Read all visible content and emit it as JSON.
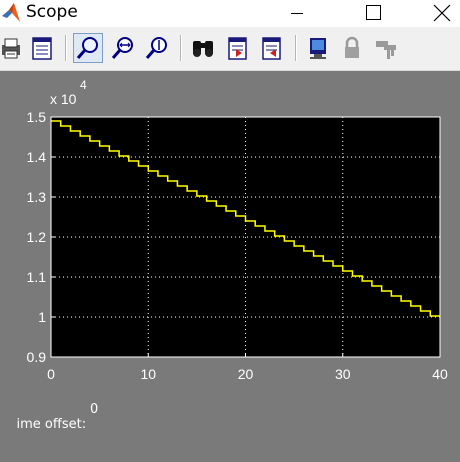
{
  "window": {
    "title": "Scope"
  },
  "titlebar_icons": [
    "matlab-logo-icon",
    "minimize-icon",
    "maximize-icon",
    "close-icon"
  ],
  "toolbar": {
    "buttons": [
      {
        "name": "print-icon"
      },
      {
        "name": "parameters-icon"
      },
      {
        "name": "zoom-icon"
      },
      {
        "name": "zoom-x-icon"
      },
      {
        "name": "zoom-y-icon"
      },
      {
        "name": "autoscale-binoculars-icon"
      },
      {
        "name": "save-axes-settings-icon"
      },
      {
        "name": "restore-axes-settings-icon"
      },
      {
        "name": "floating-scope-icon"
      },
      {
        "name": "lock-axes-icon"
      },
      {
        "name": "signal-selection-icon"
      }
    ]
  },
  "status": {
    "label": "ime offset:",
    "value": "0"
  },
  "colors": {
    "axes_bg": "#000000",
    "figure_bg": "#7a7a7a",
    "line": "#ffff00",
    "grid": "#ffffff",
    "text": "#ffffff"
  },
  "chart_data": {
    "type": "line",
    "title": "",
    "xlabel": "",
    "ylabel": "",
    "xlim": [
      0,
      40
    ],
    "ylim": [
      0.9,
      1.5
    ],
    "y_exponent_label": "x 10",
    "y_exponent_power": "4",
    "grid": true,
    "xticks": [
      0,
      10,
      20,
      30,
      40
    ],
    "xtick_labels": [
      "0",
      "10",
      "20",
      "30",
      "40"
    ],
    "yticks": [
      0.9,
      1.0,
      1.1,
      1.2,
      1.3,
      1.4,
      1.5
    ],
    "ytick_labels": [
      "0.9",
      "1",
      "1.1",
      "1.2",
      "1.3",
      "1.4",
      "1.5"
    ],
    "series": [
      {
        "style": "staircase",
        "x": [
          0,
          1,
          2,
          3,
          4,
          5,
          6,
          7,
          8,
          9,
          10,
          11,
          12,
          13,
          14,
          15,
          16,
          17,
          18,
          19,
          20,
          21,
          22,
          23,
          24,
          25,
          26,
          27,
          28,
          29,
          30,
          31,
          32,
          33,
          34,
          35,
          36,
          37,
          38,
          39,
          40
        ],
        "values": [
          1.49,
          1.4775,
          1.465,
          1.4525,
          1.44,
          1.4275,
          1.415,
          1.4025,
          1.39,
          1.3775,
          1.365,
          1.3525,
          1.34,
          1.3275,
          1.315,
          1.3025,
          1.29,
          1.2775,
          1.265,
          1.2525,
          1.24,
          1.2275,
          1.215,
          1.2025,
          1.19,
          1.1775,
          1.165,
          1.1525,
          1.14,
          1.1275,
          1.115,
          1.1025,
          1.09,
          1.0775,
          1.065,
          1.0525,
          1.04,
          1.0275,
          1.015,
          1.0025,
          1.0025
        ]
      }
    ]
  }
}
